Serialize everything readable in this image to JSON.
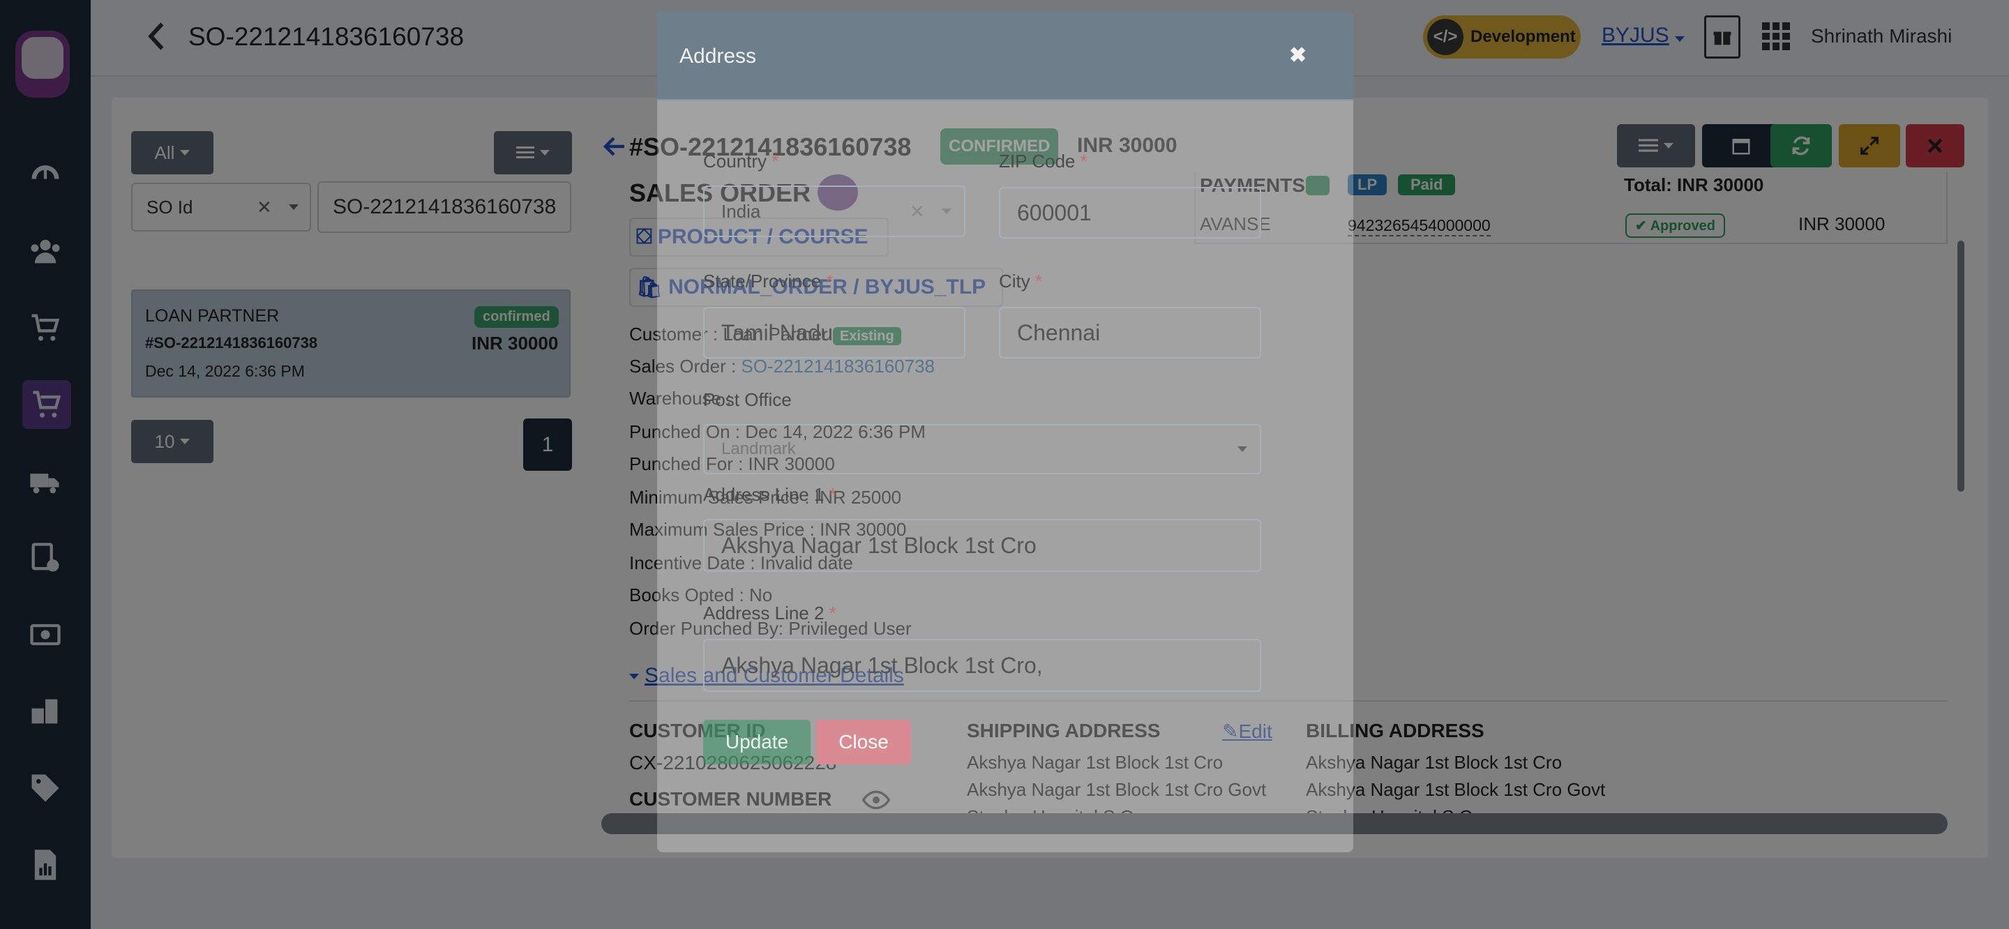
{
  "header": {
    "title": "SO-2212141836160738",
    "env_badge": "Development",
    "org": "BYJUS",
    "user_name": "Shrinath Mirashi"
  },
  "left_panel": {
    "filter_all": "All",
    "search_field": "SO Id",
    "search_value": "SO-2212141836160738",
    "order_card": {
      "partner": "LOAN PARTNER",
      "status": "confirmed",
      "order_id": "#SO-2212141836160738",
      "amount": "INR 30000",
      "date": "Dec 14, 2022 6:36 PM"
    },
    "page_size": "10",
    "current_page": "1"
  },
  "order": {
    "id": "#SO-2212141836160738",
    "status": "CONFIRMED",
    "amount": "INR 30000",
    "heading": "SALES ORDER",
    "product_link": "PRODUCT / COURSE",
    "order_type": "NORMAL_ORDER / BYJUS_TLP",
    "customer_label": "Customer : Loan Partner",
    "customer_badge": "Existing",
    "sales_order_label": "Sales Order : ",
    "sales_order_link": "SO-2212141836160738",
    "warehouse": "Warehouse :",
    "punched_on": "Punched On : Dec 14, 2022 6:36 PM",
    "punched_for": "Punched For : INR 30000",
    "min_price": "Minimum Sales Price : INR 25000",
    "max_price": "Maximum Sales Price : INR 30000",
    "incentive_date": "Incentive Date : Invalid date",
    "books_opted": "Books Opted : No",
    "punched_by": "Order Punched By: Privileged User",
    "details_toggle": "Sales and Customer Details",
    "customer_id_label": "CUSTOMER ID",
    "customer_id": "CX-2210280625062228",
    "customer_number_label": "CUSTOMER NUMBER",
    "shipping_label": "SHIPPING ADDRESS",
    "edit_label": "Edit",
    "shipping_lines": [
      "Akshya Nagar 1st Block 1st Cro",
      "Akshya Nagar 1st Block 1st Cro Govt",
      "Stanley Hospital S.O"
    ],
    "billing_label": "BILLING ADDRESS",
    "billing_lines": [
      "Akshya Nagar 1st Block 1st Cro",
      "Akshya Nagar 1st Block 1st Cro Govt",
      "Stanley Hospital S.O"
    ]
  },
  "payments": {
    "heading": "PAYMENTS",
    "badge_lp": "LP",
    "badge_paid": "Paid",
    "total": "Total: INR 30000",
    "row": {
      "lender": "AVANSE",
      "ref": "9423265454000000",
      "status": "Approved",
      "amount": "INR 30000"
    }
  },
  "modal": {
    "title": "Address",
    "country_label": "Country",
    "country_value": "India",
    "zip_label": "ZIP Code",
    "zip_value": "600001",
    "state_label": "State/Province",
    "state_value": "Tamil Nadu",
    "city_label": "City",
    "city_value": "Chennai",
    "post_office_label": "Post Office",
    "post_office_placeholder": "Landmark",
    "address1_label": "Address Line 1",
    "address1_value": "Akshya Nagar 1st Block 1st Cro",
    "address2_label": "Address Line 2",
    "address2_value": "Akshya Nagar 1st Block 1st Cro,",
    "update_label": "Update",
    "close_label": "Close",
    "required_mark": "*"
  },
  "colors": {
    "sidebar": "#1f2b3a",
    "accent_green": "#3aa36a",
    "accent_red": "#d23a4a",
    "accent_yellow": "#e0b23a",
    "link_blue": "#2255cc",
    "modal_header": "#6f7e8b"
  }
}
